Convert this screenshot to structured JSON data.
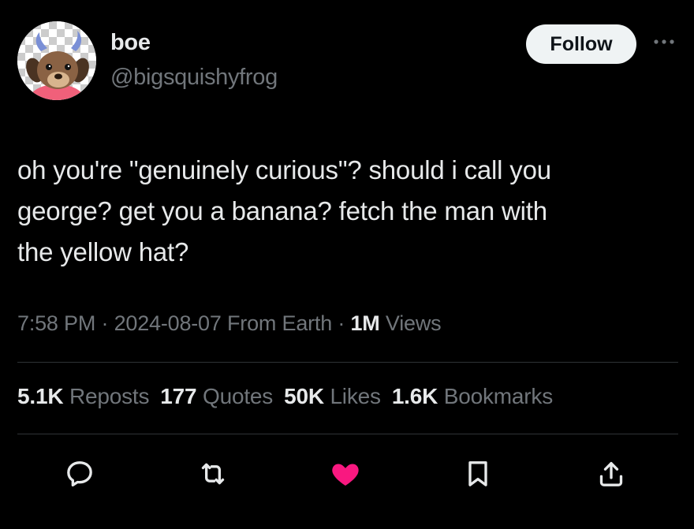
{
  "author": {
    "display_name": "boe",
    "handle": "@bigsquishyfrog",
    "follow_label": "Follow",
    "more_icon": "more-horizontal-icon"
  },
  "tweet": {
    "text": "oh you're \"genuinely curious\"? should i call you\ngeorge? get you a banana? fetch the man with\nthe yellow hat?",
    "time": "7:58 PM",
    "date": "2024-08-07",
    "source": "From Earth",
    "separator": "·",
    "views_count": "1M",
    "views_label": "Views"
  },
  "stats": {
    "reposts_count": "5.1K",
    "reposts_label": "Reposts",
    "quotes_count": "177",
    "quotes_label": "Quotes",
    "likes_count": "50K",
    "likes_label": "Likes",
    "bookmarks_count": "1.6K",
    "bookmarks_label": "Bookmarks"
  },
  "actions": {
    "reply_icon": "reply-icon",
    "repost_icon": "repost-icon",
    "like_icon": "heart-icon",
    "like_active": true,
    "bookmark_icon": "bookmark-icon",
    "share_icon": "share-icon"
  },
  "colors": {
    "background": "#000000",
    "text_primary": "#e7e9ea",
    "text_secondary": "#71767b",
    "divider": "#2f3336",
    "like_active": "#f91880",
    "follow_bg": "#eff3f4"
  }
}
